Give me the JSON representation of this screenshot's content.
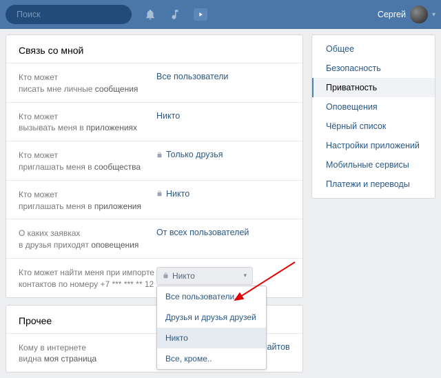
{
  "header": {
    "search_placeholder": "Поиск",
    "username": "Сергей"
  },
  "sections": {
    "contact_title": "Связь со мной",
    "other_title": "Прочее"
  },
  "rows": {
    "messages": {
      "l1": "Кто может",
      "l2_a": "писать мне личные ",
      "l2_b": "сообщения",
      "value": "Все пользователи"
    },
    "apps_call": {
      "l1": "Кто может",
      "l2_a": "вызывать меня в ",
      "l2_b": "приложениях",
      "value": "Никто"
    },
    "invite_comm": {
      "l1": "Кто может",
      "l2_a": "приглашать меня в ",
      "l2_b": "сообщества",
      "value": "Только друзья"
    },
    "invite_apps": {
      "l1": "Кто может",
      "l2_a": "приглашать меня в ",
      "l2_b": "приложения",
      "value": "Никто"
    },
    "friend_requests": {
      "l1": "О каких заявках",
      "l2_a": "в друзья приходят ",
      "l2_b": "оповещения",
      "value": "От всех пользователей"
    },
    "import": {
      "l1_a": "Кто может найти меня при импорте",
      "l1_b": "контактов по номеру +7 *** *** ** 12",
      "value": "Никто"
    },
    "page_visible": {
      "l1": "Кому в интернете",
      "l2_a": "видна ",
      "l2_b": "моя страница",
      "value": "Всем, кроме поисковых сайтов"
    }
  },
  "dropdown": {
    "options": {
      "all": "Все пользователи",
      "friends_friends": "Друзья и друзья друзей",
      "nobody": "Никто",
      "except": "Все, кроме.."
    }
  },
  "sidebar": {
    "general": "Общее",
    "security": "Безопасность",
    "privacy": "Приватность",
    "notifications": "Оповещения",
    "blacklist": "Чёрный список",
    "app_settings": "Настройки приложений",
    "mobile": "Мобильные сервисы",
    "payments": "Платежи и переводы"
  }
}
